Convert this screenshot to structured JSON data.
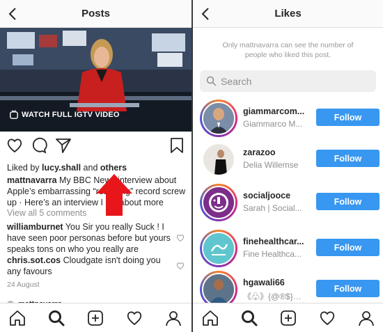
{
  "left": {
    "header": {
      "title": "Posts"
    },
    "video": {
      "watch_label": "WATCH FULL IGTV VIDEO"
    },
    "likes": {
      "prefix": "Liked by ",
      "user": "lucy.shall",
      "joiner": " and ",
      "others": "others"
    },
    "caption": {
      "user": "mattnavarra",
      "text": " My BBC News interview about Apple’s embarrassing “returning” record screw up · Here’s an interview I did about more"
    },
    "view_comments": "View all 5 comments",
    "comments": [
      {
        "user": "williamburnet",
        "text": " You Sir you really Suck ! I have seen poor personas before but yours speaks tons on who you really are"
      },
      {
        "user": "chris.sot.cos",
        "text": " Cloudgate isn't doing you any favours"
      }
    ],
    "date": "24 August",
    "next_post_user": "mattnavarra"
  },
  "right": {
    "header": {
      "title": "Likes"
    },
    "note": "Only mattnavarra can see the number of people who liked this post.",
    "search": {
      "placeholder": "Search"
    },
    "follow_label": "Follow",
    "users": [
      {
        "username": "giammarcom...",
        "fullname": "Giammarco M..."
      },
      {
        "username": "zarazoo",
        "fullname": "Delia Willemse"
      },
      {
        "username": "socialjooce",
        "fullname": "Sarah | Social..."
      },
      {
        "username": "finehealthcar...",
        "fullname": "Fine Healthca..."
      },
      {
        "username": "hgawali66",
        "fullname": "《♧》{@®$}《♧》"
      }
    ]
  },
  "colors": {
    "follow": "#3897f0",
    "arrow": "#e8151b",
    "border": "#dbdbdb"
  },
  "icons": [
    "back-icon",
    "heart-icon",
    "comment-icon",
    "share-icon",
    "bookmark-icon",
    "home-icon",
    "search-icon",
    "add-icon",
    "activity-icon",
    "profile-icon",
    "igtv-icon"
  ]
}
